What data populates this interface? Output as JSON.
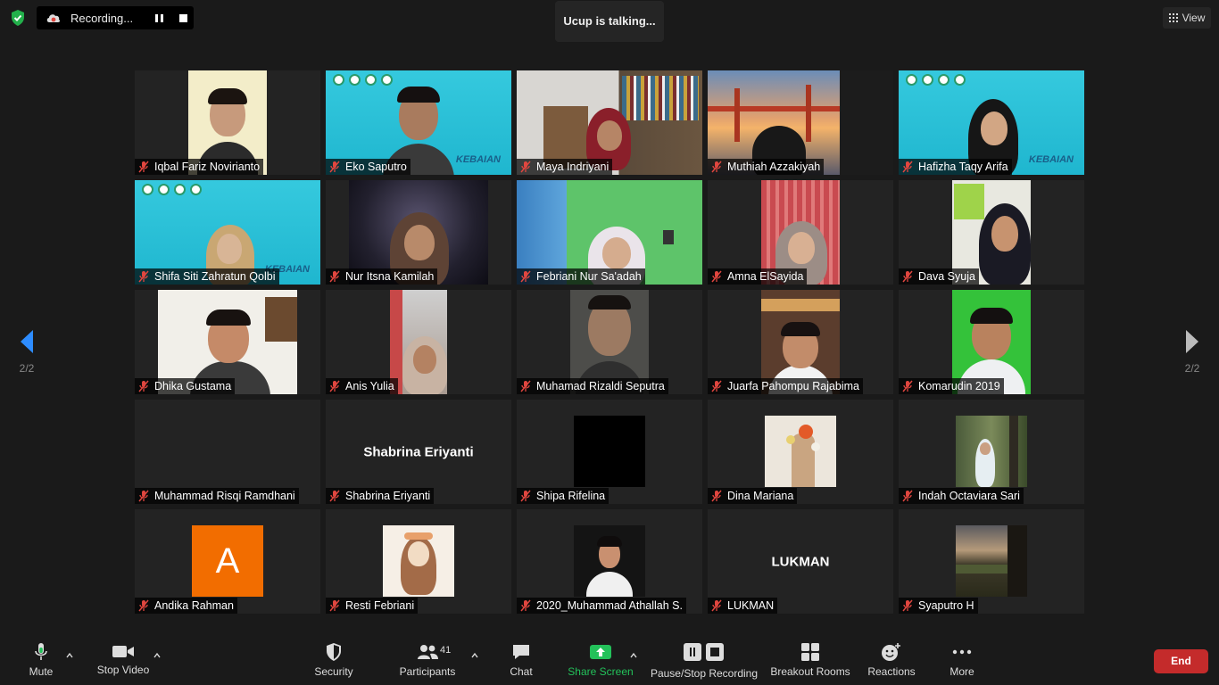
{
  "top": {
    "recording_label": "Recording...",
    "talking": "Ucup is talking...",
    "view_label": "View"
  },
  "pagination": {
    "left": "2/2",
    "right": "2/2"
  },
  "participants": [
    {
      "name": "Iqbal Fariz Novirianto",
      "muted": true
    },
    {
      "name": "Eko Saputro",
      "muted": true
    },
    {
      "name": "Maya Indriyani",
      "muted": true
    },
    {
      "name": "Muthiah Azzakiyah",
      "muted": true
    },
    {
      "name": "Hafizha Taqy Arifa",
      "muted": true
    },
    {
      "name": "Shifa Siti Zahratun Qolbi",
      "muted": true
    },
    {
      "name": "Nur Itsna Kamilah",
      "muted": true
    },
    {
      "name": "Febriani Nur Sa'adah",
      "muted": true
    },
    {
      "name": "Amna ElSayida",
      "muted": true
    },
    {
      "name": "Dava Syuja",
      "muted": true
    },
    {
      "name": "Dhika Gustama",
      "muted": true
    },
    {
      "name": "Anis Yulia",
      "muted": true
    },
    {
      "name": "Muhamad Rizaldi Seputra",
      "muted": true
    },
    {
      "name": "Juarfa Pahompu Rajabima",
      "muted": true
    },
    {
      "name": "Komarudin 2019",
      "muted": true
    },
    {
      "name": "Muhammad Risqi Ramdhani",
      "muted": true
    },
    {
      "name": "Shabrina Eriyanti",
      "muted": true,
      "center_label": "Shabrina Eriyanti"
    },
    {
      "name": "Shipa Rifelina",
      "muted": true
    },
    {
      "name": "Dina Mariana",
      "muted": true
    },
    {
      "name": "Indah Octaviara Sari",
      "muted": true
    },
    {
      "name": "Andika Rahman",
      "muted": true,
      "avatar_letter": "A"
    },
    {
      "name": "Resti Febriani",
      "muted": true
    },
    {
      "name": "2020_Muhammad Athallah S.",
      "muted": true
    },
    {
      "name": "LUKMAN",
      "muted": true,
      "center_label": "LUKMAN"
    },
    {
      "name": "Syaputro H",
      "muted": true
    }
  ],
  "banner": {
    "title": "KEBAIAN"
  },
  "toolbar": {
    "mute": "Mute",
    "stop_video": "Stop Video",
    "security": "Security",
    "participants": "Participants",
    "participants_count": "41",
    "chat": "Chat",
    "share_screen": "Share Screen",
    "recording": "Pause/Stop Recording",
    "breakout": "Breakout Rooms",
    "reactions": "Reactions",
    "more": "More",
    "end": "End"
  },
  "colors": {
    "background": "#1a1a1a",
    "tile": "#232323",
    "muted_red": "#e0463f",
    "share_green": "#23c15a",
    "end_red": "#c42b2b",
    "banner_cyan": "#2cc6dc",
    "arrow_blue": "#2d8cff",
    "avatar_orange": "#f26d00"
  },
  "icons": {
    "mic_muted": "mic-muted-icon",
    "shield": "shield-icon",
    "cloud": "cloud-record-icon"
  }
}
